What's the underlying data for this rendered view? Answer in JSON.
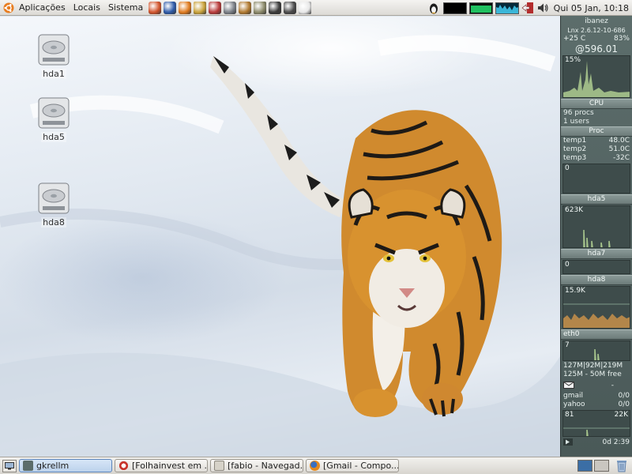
{
  "top_panel": {
    "menus": [
      "Aplicações",
      "Locais",
      "Sistema"
    ],
    "launchers": [
      {
        "icon": "firefox-icon",
        "color": "#d2542c"
      },
      {
        "icon": "globe-icon",
        "color": "#2d5aa8"
      },
      {
        "icon": "skype-icon",
        "color": "#e07b1f"
      },
      {
        "icon": "trophy-icon",
        "color": "#c9a23a"
      },
      {
        "icon": "no-icon",
        "color": "#b83a3a"
      },
      {
        "icon": "camera-icon",
        "color": "#7a7f86"
      },
      {
        "icon": "home-icon",
        "color": "#b0792f"
      },
      {
        "icon": "notes-icon",
        "color": "#8c8a6a"
      },
      {
        "icon": "terminal-icon",
        "color": "#3a3a3a"
      },
      {
        "icon": "nautilus-icon",
        "color": "#4a4a4a"
      },
      {
        "icon": "document-icon",
        "color": "#e8e8e8"
      }
    ],
    "clock": "Qui 05 Jan, 10:18"
  },
  "desktop": {
    "icons": [
      {
        "label": "hda1",
        "icon": "harddisk-icon"
      },
      {
        "label": "hda5",
        "icon": "harddisk-icon"
      },
      {
        "label": "hda8",
        "icon": "harddisk-icon"
      }
    ]
  },
  "gkrellm": {
    "hostname": "ibanez",
    "kernel": "Lnx 2.6.12-10-686",
    "temp": "+25 C",
    "battery": "83%",
    "cpu_freq": "@596.01",
    "cpu_percent": "15%",
    "cpu_label": "CPU",
    "procs": "96 procs",
    "users": "1 users",
    "proc_label": "Proc",
    "temps": [
      {
        "name": "temp1",
        "value": "48.0C"
      },
      {
        "name": "temp2",
        "value": "51.0C"
      },
      {
        "name": "temp3",
        "value": "-32C"
      }
    ],
    "hda5_value": "0",
    "hda5_label": "hda5",
    "hda7_value": "623K",
    "hda7_label": "hda7",
    "hda8_value": "0",
    "hda8_label": "hda8",
    "eth0_value": "15.9K",
    "eth0_label": "eth0",
    "mem_value": "7",
    "mem_line": "127M|92M|219M",
    "swap_line": "125M - 50M free",
    "mail": [
      {
        "name": "gmail",
        "value": "0/0"
      },
      {
        "name": "yahoo",
        "value": "0/0"
      }
    ],
    "net_left": "81",
    "net_right": "22K",
    "uptime": "0d  2:39"
  },
  "bottom_panel": {
    "tasks": [
      {
        "label": "gkrellm",
        "icon": "gkrellm-icon",
        "active": true
      },
      {
        "label": "[Folhainvest em ...",
        "icon": "opera-icon",
        "active": false
      },
      {
        "label": "[fabio - Navegad...",
        "icon": "folder-icon",
        "active": false
      },
      {
        "label": "[Gmail - Compo...",
        "icon": "firefox-icon",
        "active": false
      }
    ],
    "workspaces": 2
  }
}
